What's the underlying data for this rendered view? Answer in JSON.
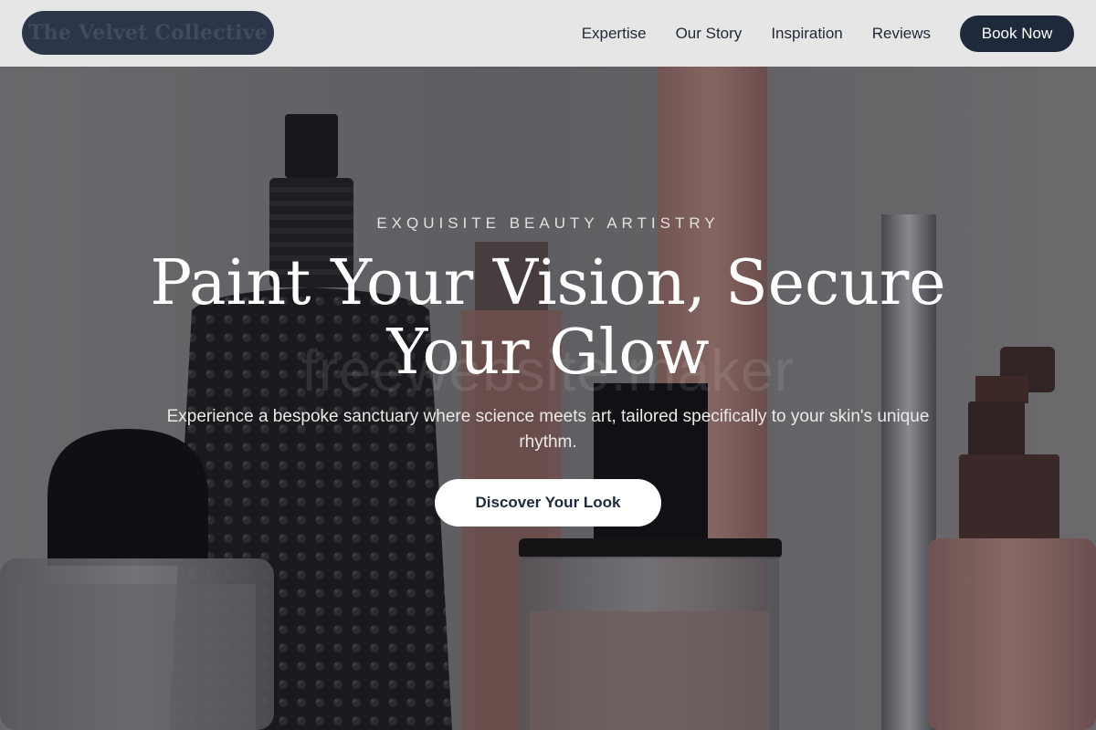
{
  "header": {
    "logo_text": "The Velvet Collective",
    "nav": [
      "Expertise",
      "Our Story",
      "Inspiration",
      "Reviews"
    ],
    "cta_label": "Book Now"
  },
  "hero": {
    "eyebrow": "EXQUISITE BEAUTY ARTISTRY",
    "headline": "Paint Your Vision, Secure Your Glow",
    "subtext": "Experience a bespoke sanctuary where science meets art, tailored specifically to your skin's unique rhythm.",
    "cta_label": "Discover Your Look",
    "watermark": "freewebsite.maker"
  },
  "colors": {
    "header_bg": "#e6e6e6",
    "brand_navy": "#1e293b",
    "logo_pill": "#2b3649",
    "hero_text": "#ffffff",
    "cta_bg": "#ffffff"
  }
}
